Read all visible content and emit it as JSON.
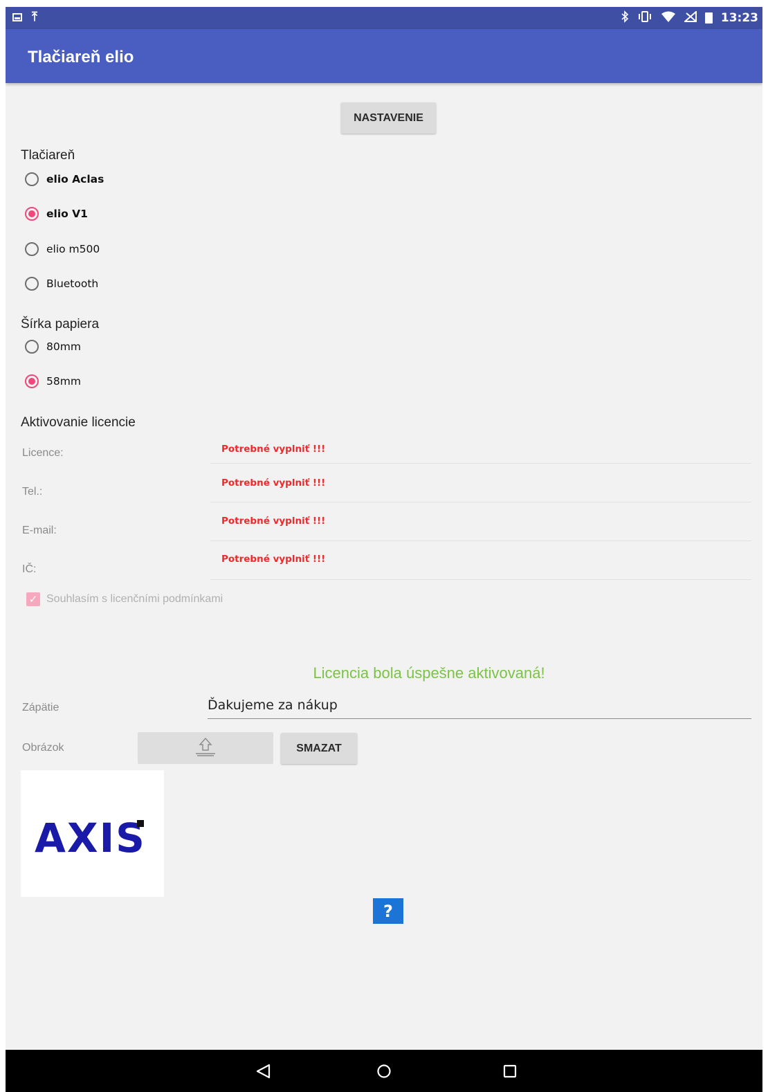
{
  "status_bar": {
    "time": "13:23",
    "left_icons": [
      "image-icon",
      "upload-icon"
    ],
    "right_icons": [
      "bluetooth-icon",
      "vibrate-icon",
      "wifi-icon",
      "no-signal-icon",
      "battery-icon"
    ]
  },
  "app_bar": {
    "title": "Tlačiareň elio"
  },
  "settings_button": {
    "label": "NASTAVENIE"
  },
  "printer": {
    "heading": "Tlačiareň",
    "options": [
      {
        "label": "elio Aclas",
        "checked": false
      },
      {
        "label": "elio V1",
        "checked": true
      },
      {
        "label": "elio m500",
        "checked": false
      },
      {
        "label": "Bluetooth",
        "checked": false
      }
    ]
  },
  "paper_width": {
    "heading": "Šírka papiera",
    "options": [
      {
        "label": "80mm",
        "checked": false
      },
      {
        "label": "58mm",
        "checked": true
      }
    ]
  },
  "license": {
    "heading": "Aktivovanie licencie",
    "fields": [
      {
        "label": "Licence:",
        "warning": "Potrebné vyplniť !!!"
      },
      {
        "label": "Tel.:",
        "warning": "Potrebné vyplniť !!!"
      },
      {
        "label": "E-mail:",
        "warning": "Potrebné vyplniť !!!"
      },
      {
        "label": "IČ:",
        "warning": "Potrebné vyplniť !!!"
      }
    ],
    "agree_label": "Souhlasím s licenčními podmínkami",
    "agree_checked": true,
    "success_message": "Licencia bola úspešne aktivovaná!"
  },
  "footer": {
    "label": "Zápätie",
    "value": "Ďakujeme za nákup"
  },
  "image": {
    "label": "Obrázok",
    "upload_icon": "upload-icon",
    "delete_button": "SMAZAT",
    "logo_text": "AXIS"
  },
  "help_button": {
    "label": "?"
  },
  "nav_bar": {
    "icons": [
      "back-icon",
      "home-icon",
      "recents-icon"
    ]
  },
  "colors": {
    "app_bar": "#4a5ec1",
    "status_bar": "#3f4fa3",
    "accent": "#f0487c",
    "warning": "#ee2a2a",
    "success": "#7cc247",
    "help": "#1b74d6",
    "logo": "#1a1aa8"
  }
}
